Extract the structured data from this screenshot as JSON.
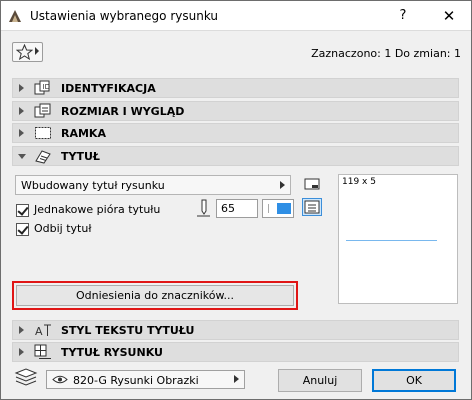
{
  "window": {
    "title": "Ustawienia wybranego rysunku",
    "help_label": "?",
    "close_label": "✕"
  },
  "header": {
    "selection_info": "Zaznaczono: 1 Do zmian: 1"
  },
  "panels": [
    {
      "label": "IDENTYFIKACJA",
      "icon": "identification-icon",
      "expanded": false
    },
    {
      "label": "ROZMIAR I WYGLĄD",
      "icon": "size-appearance-icon",
      "expanded": false
    },
    {
      "label": "RAMKA",
      "icon": "frame-icon",
      "expanded": false
    },
    {
      "label": "TYTUŁ",
      "icon": "title-icon",
      "expanded": true
    },
    {
      "label": "STYL TEKSTU TYTUŁU",
      "icon": "title-text-style-icon",
      "expanded": false
    },
    {
      "label": "TYTUŁ RYSUNKU",
      "icon": "drawing-title-icon",
      "expanded": false
    }
  ],
  "title_panel": {
    "title_type": "Wbudowany tytuł rysunku",
    "same_pens_label": "Jednakowe pióra tytułu",
    "same_pens_checked": true,
    "pen_value": "65",
    "pen_color": "#2f8fe5",
    "flip_title_label": "Odbij tytuł",
    "flip_title_checked": true,
    "preview_size": "119 x 5",
    "refs_button_label": "Odniesienia do znaczników..."
  },
  "footer": {
    "layer_value": "820-G Rysunki Obrazki",
    "cancel_label": "Anuluj",
    "ok_label": "OK"
  },
  "colors": {
    "highlight_border": "#e01616",
    "ok_border": "#0078d7"
  }
}
